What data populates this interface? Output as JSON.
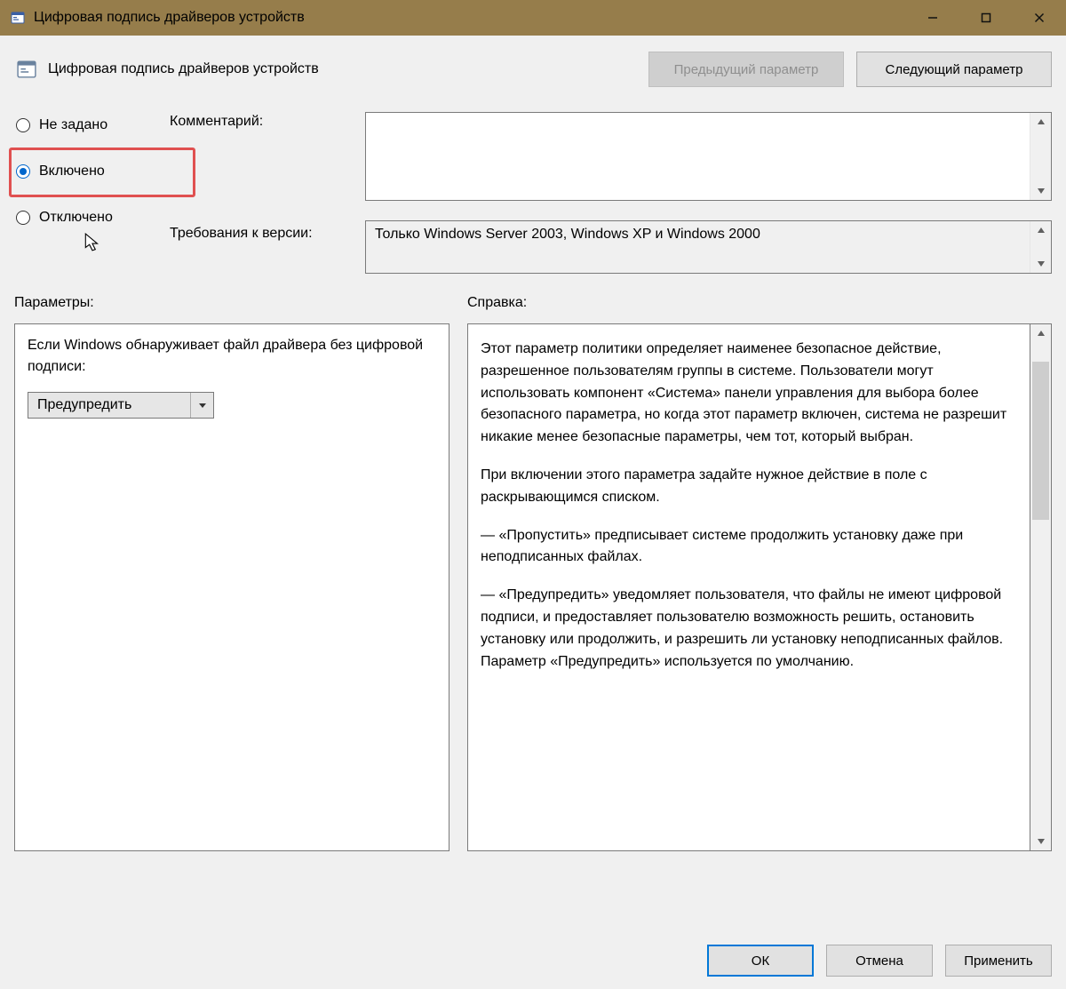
{
  "titlebar": {
    "title": "Цифровая подпись драйверов устройств"
  },
  "header": {
    "title": "Цифровая подпись драйверов устройств",
    "prev_button": "Предыдущий параметр",
    "next_button": "Следующий параметр"
  },
  "state": {
    "not_configured": "Не задано",
    "enabled": "Включено",
    "disabled": "Отключено"
  },
  "labels": {
    "comment": "Комментарий:",
    "version": "Требования к версии:",
    "options": "Параметры:",
    "help": "Справка:"
  },
  "fields": {
    "comment_value": "",
    "version_value": "Только Windows Server 2003, Windows XP и Windows 2000"
  },
  "options": {
    "detection_label": "Если Windows обнаруживает файл драйвера без цифровой подписи:",
    "selected": "Предупредить"
  },
  "help": {
    "p1": "Этот параметр политики определяет наименее безопасное действие, разрешенное пользователям группы в системе. Пользователи могут использовать компонент «Система» панели управления для выбора более безопасного параметра, но когда этот параметр включен, система не разрешит никакие менее безопасные параметры, чем тот, который выбран.",
    "p2": "При включении этого параметра задайте нужное действие в поле с раскрывающимся списком.",
    "p3": "— «Пропустить» предписывает системе продолжить установку даже при неподписанных файлах.",
    "p4": "— «Предупредить» уведомляет пользователя, что файлы не имеют цифровой подписи, и предоставляет пользователю возможность решить, остановить установку или продолжить, и разрешить ли установку неподписанных файлов. Параметр «Предупредить» используется по умолчанию."
  },
  "footer": {
    "ok": "ОК",
    "cancel": "Отмена",
    "apply": "Применить"
  }
}
